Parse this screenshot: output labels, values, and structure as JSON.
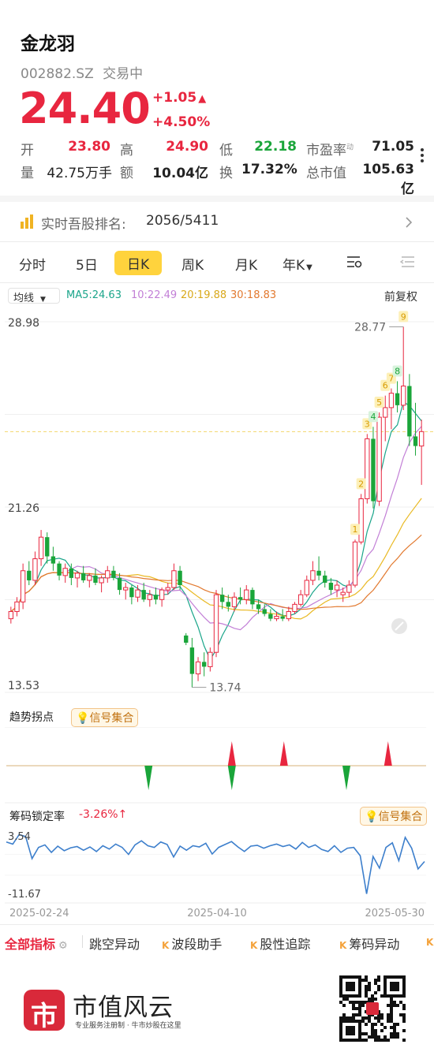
{
  "header": {
    "name": "金龙羽",
    "code": "002882.SZ",
    "status": "交易中",
    "price": "24.40",
    "change": "+1.05",
    "change_pct": "+4.50%",
    "up_arrow": "▲"
  },
  "quote": {
    "open_label": "开",
    "open": "23.80",
    "high_label": "高",
    "high": "24.90",
    "low_label": "低",
    "low": "22.18",
    "pe_label": "市盈率",
    "pe_sup": "动",
    "pe": "71.05",
    "vol_label": "量",
    "vol": "42.75万手",
    "amt_label": "额",
    "amt": "10.04亿",
    "turn_label": "换",
    "turn": "17.32%",
    "mcap_label": "总市值",
    "mcap": "105.63亿"
  },
  "rank": {
    "label": "实时吾股排名:",
    "value": "2056/5411"
  },
  "tabs": [
    "分时",
    "5日",
    "日K",
    "周K",
    "月K",
    "年K"
  ],
  "active_tab": "日K",
  "chart_toolbar": {
    "ma_select": "均线",
    "ma5": "MA5:24.63",
    "ma10": "10:22.49",
    "ma20": "20:19.88",
    "ma30": "30:18.83",
    "adjust": "前复权"
  },
  "colors": {
    "up": "#e8263f",
    "down": "#1aa53a",
    "ma5": "#1aa58a",
    "ma10": "#c27fd6",
    "ma20": "#e9b923",
    "ma30": "#e2792f",
    "lock_line": "#3d7fcc",
    "accent": "#ffd33d"
  },
  "chart_data": [
    {
      "type": "candlestick",
      "y_axis_labels": [
        "28.98",
        "21.26",
        "13.53"
      ],
      "high_annotation": "28.77",
      "low_annotation": "13.74",
      "ylim": [
        13.53,
        28.98
      ],
      "current_price_line": 24.4,
      "markers": [
        "1",
        "2",
        "3",
        "4",
        "5",
        "6",
        "7",
        "8",
        "9"
      ],
      "candles": [
        [
          16.6,
          17.1,
          16.4,
          16.9
        ],
        [
          16.9,
          17.5,
          16.7,
          17.3
        ],
        [
          17.3,
          18.9,
          17.0,
          18.6
        ],
        [
          18.6,
          19.0,
          18.0,
          18.2
        ],
        [
          18.2,
          19.4,
          18.0,
          19.1
        ],
        [
          19.1,
          20.3,
          18.8,
          20.0
        ],
        [
          20.0,
          20.2,
          18.9,
          19.2
        ],
        [
          19.2,
          19.6,
          18.6,
          18.9
        ],
        [
          18.9,
          19.0,
          18.2,
          18.4
        ],
        [
          18.4,
          18.9,
          18.1,
          18.7
        ],
        [
          18.7,
          18.9,
          18.0,
          18.3
        ],
        [
          18.3,
          18.6,
          17.9,
          18.5
        ],
        [
          18.5,
          18.8,
          18.1,
          18.2
        ],
        [
          18.2,
          18.5,
          17.9,
          18.4
        ],
        [
          18.4,
          18.7,
          18.0,
          18.1
        ],
        [
          18.1,
          18.4,
          17.7,
          18.3
        ],
        [
          18.3,
          18.8,
          18.1,
          18.6
        ],
        [
          18.6,
          18.8,
          18.2,
          18.3
        ],
        [
          18.3,
          18.5,
          17.6,
          17.8
        ],
        [
          17.8,
          18.1,
          17.4,
          17.9
        ],
        [
          17.9,
          18.0,
          17.2,
          17.5
        ],
        [
          17.5,
          18.0,
          17.3,
          17.8
        ],
        [
          17.8,
          18.1,
          17.3,
          17.4
        ],
        [
          17.4,
          17.8,
          17.1,
          17.6
        ],
        [
          17.6,
          17.9,
          17.2,
          17.4
        ],
        [
          17.4,
          17.9,
          17.1,
          17.8
        ],
        [
          17.8,
          18.1,
          17.6,
          17.9
        ],
        [
          17.9,
          18.9,
          17.8,
          18.6
        ],
        [
          18.6,
          18.8,
          17.8,
          18.0
        ],
        [
          15.9,
          16.0,
          15.5,
          15.6
        ],
        [
          15.4,
          15.8,
          13.74,
          14.3
        ],
        [
          14.3,
          15.0,
          14.0,
          14.8
        ],
        [
          14.8,
          15.2,
          14.2,
          14.6
        ],
        [
          14.6,
          15.4,
          14.4,
          15.2
        ],
        [
          15.2,
          17.8,
          15.0,
          17.6
        ],
        [
          17.6,
          17.9,
          17.0,
          17.3
        ],
        [
          17.3,
          17.6,
          16.9,
          17.1
        ],
        [
          17.1,
          17.7,
          16.9,
          17.5
        ],
        [
          17.5,
          17.9,
          17.2,
          17.4
        ],
        [
          17.4,
          18.0,
          17.2,
          17.8
        ],
        [
          17.8,
          17.9,
          17.0,
          17.2
        ],
        [
          17.2,
          17.4,
          16.8,
          17.0
        ],
        [
          17.0,
          17.2,
          16.7,
          16.8
        ],
        [
          16.8,
          17.0,
          16.5,
          16.6
        ],
        [
          16.6,
          16.9,
          16.5,
          16.7
        ],
        [
          16.7,
          17.0,
          16.5,
          16.6
        ],
        [
          16.6,
          17.1,
          16.5,
          16.9
        ],
        [
          16.9,
          17.3,
          16.8,
          17.2
        ],
        [
          17.2,
          17.8,
          17.1,
          17.6
        ],
        [
          17.6,
          18.4,
          17.5,
          18.2
        ],
        [
          18.2,
          19.0,
          18.0,
          18.6
        ],
        [
          18.6,
          19.2,
          18.2,
          18.4
        ],
        [
          18.4,
          18.6,
          17.9,
          18.1
        ],
        [
          18.1,
          18.3,
          17.6,
          17.8
        ],
        [
          17.8,
          18.2,
          17.5,
          18.0
        ],
        [
          17.6,
          17.9,
          17.3,
          17.7
        ],
        [
          17.7,
          18.2,
          17.5,
          18.0
        ],
        [
          18.0,
          19.9,
          17.9,
          19.8
        ],
        [
          19.8,
          21.8,
          19.7,
          21.6
        ],
        [
          21.6,
          24.3,
          21.4,
          24.1
        ],
        [
          24.1,
          24.6,
          21.2,
          21.5
        ],
        [
          21.5,
          25.2,
          21.3,
          25.0
        ],
        [
          25.0,
          25.9,
          24.0,
          25.4
        ],
        [
          25.4,
          26.2,
          24.5,
          26.0
        ],
        [
          26.0,
          26.5,
          25.2,
          25.5
        ],
        [
          25.5,
          28.77,
          25.3,
          26.3
        ],
        [
          26.3,
          26.8,
          23.8,
          24.2
        ],
        [
          24.2,
          25.6,
          23.4,
          23.8
        ],
        [
          23.8,
          24.9,
          22.18,
          24.4
        ]
      ]
    },
    {
      "type": "signal",
      "title": "趋势拐点",
      "signals": [
        {
          "index": 13,
          "dir": "down"
        },
        {
          "index": 21,
          "dir": "up"
        },
        {
          "index": 21,
          "dir": "down"
        },
        {
          "index": 26,
          "dir": "up"
        },
        {
          "index": 32,
          "dir": "down"
        },
        {
          "index": 36,
          "dir": "up"
        }
      ]
    },
    {
      "type": "line",
      "title": "筹码锁定率",
      "current_value": "-3.26%",
      "y_axis_labels": [
        "3.54",
        "-11.67"
      ],
      "ylim": [
        -11.67,
        3.54
      ],
      "x_tick_labels": [
        "2025-02-24",
        "2025-04-10",
        "2025-05-30"
      ],
      "values": [
        1.5,
        1.0,
        3.3,
        2.8,
        -2.5,
        0.2,
        0.8,
        -1.0,
        0.5,
        -0.6,
        0.1,
        0.4,
        -0.5,
        0.3,
        -0.8,
        0.6,
        -0.2,
        1.0,
        0.2,
        -1.5,
        0.8,
        1.8,
        0.6,
        0.2,
        1.5,
        0.9,
        -2.1,
        0.5,
        -0.5,
        0.6,
        0.3,
        1.2,
        -1.4,
        0.2,
        0.9,
        1.6,
        0.3,
        -0.8,
        0.5,
        0.7,
        0.0,
        0.6,
        1.0,
        0.4,
        0.8,
        -0.2,
        1.4,
        0.2,
        0.8,
        -0.3,
        -0.8,
        0.6,
        -1.0,
        0.0,
        0.2,
        -1.8,
        -11.0,
        -2.0,
        -4.8,
        0.2,
        1.3,
        -3.0,
        2.6,
        0.0,
        -5.0,
        -3.2
      ]
    }
  ],
  "signal_button": "信号集合",
  "lock_change_arrow": "↑",
  "indicator_tabs": [
    "全部指标",
    "跳空异动",
    "波段助手",
    "股性追踪",
    "筹码异动"
  ],
  "brand": {
    "name": "市值风云",
    "slogan": "专业服务注册制 · 牛市炒股在这里",
    "logo_text": "市"
  }
}
